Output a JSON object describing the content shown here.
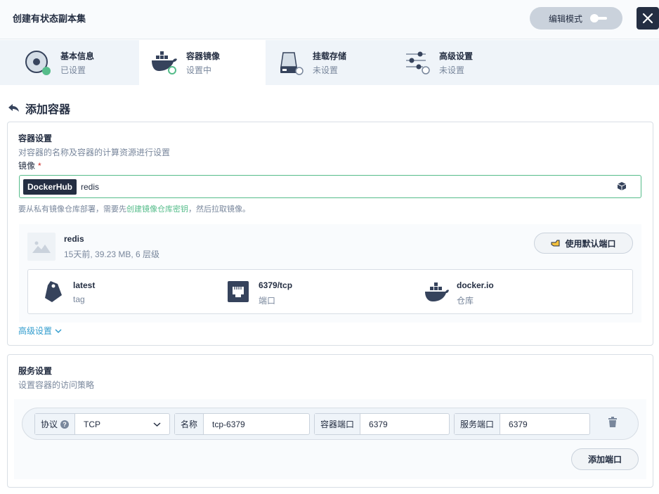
{
  "header": {
    "title": "创建有状态副本集",
    "edit_mode_label": "编辑模式"
  },
  "steps": [
    {
      "title": "基本信息",
      "status": "已设置"
    },
    {
      "title": "容器镜像",
      "status": "设置中"
    },
    {
      "title": "挂载存储",
      "status": "未设置"
    },
    {
      "title": "高级设置",
      "status": "未设置"
    }
  ],
  "back_title": "添加容器",
  "container_settings": {
    "title": "容器设置",
    "description": "对容器的名称及容器的计算资源进行设置",
    "image_label": "镜像",
    "required_mark": "*",
    "registry": "DockerHub",
    "image_value": "redis",
    "hint_prefix": "要从私有镜像仓库部署，需要先",
    "hint_link": "创建镜像仓库密钥",
    "hint_suffix": "，然后拉取镜像。",
    "image": {
      "name": "redis",
      "meta": "15天前, 39.23 MB, 6 层级",
      "default_port_button": "使用默认端口",
      "details": [
        {
          "value": "latest",
          "label": "tag",
          "icon": "tag-icon"
        },
        {
          "value": "6379/tcp",
          "label": "端口",
          "icon": "ethernet-port-icon"
        },
        {
          "value": "docker.io",
          "label": "仓库",
          "icon": "docker-icon"
        }
      ]
    },
    "advanced_link": "高级设置"
  },
  "service_settings": {
    "title": "服务设置",
    "description": "设置容器的访问策略",
    "port": {
      "protocol_label": "协议",
      "help_mark": "?",
      "protocol_value": "TCP",
      "name_label": "名称",
      "name_value": "tcp-6379",
      "container_port_label": "容器端口",
      "container_port_value": "6379",
      "service_port_label": "服务端口",
      "service_port_value": "6379"
    },
    "add_port_button": "添加端口"
  },
  "colors": {
    "accent_green": "#55bc8a",
    "dark": "#242e42",
    "muted": "#79879c",
    "link_blue": "#329dce"
  }
}
